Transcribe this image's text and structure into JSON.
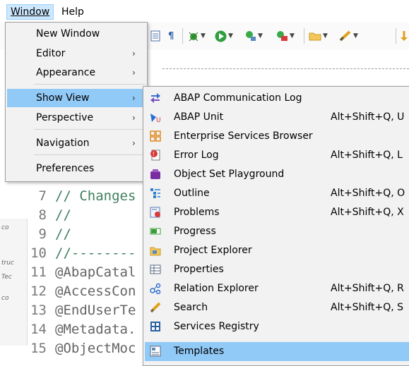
{
  "menubar": {
    "window": "Window",
    "help": "Help"
  },
  "window_menu": {
    "items": [
      {
        "label": "New Window",
        "has_submenu": false
      },
      {
        "label": "Editor",
        "has_submenu": true
      },
      {
        "label": "Appearance",
        "has_submenu": true
      },
      {
        "label": "Show View",
        "has_submenu": true,
        "highlighted": true
      },
      {
        "label": "Perspective",
        "has_submenu": true
      },
      {
        "label": "Navigation",
        "has_submenu": true
      },
      {
        "label": "Preferences",
        "has_submenu": false
      }
    ],
    "arrow": "›"
  },
  "show_view_menu": {
    "items": [
      {
        "label": "ABAP Communication Log",
        "accelerator": "",
        "icon": "communication-log-icon"
      },
      {
        "label": "ABAP Unit",
        "accelerator": "Alt+Shift+Q, U",
        "icon": "abap-unit-icon"
      },
      {
        "label": "Enterprise Services Browser",
        "accelerator": "",
        "icon": "enterprise-services-icon"
      },
      {
        "label": "Error Log",
        "accelerator": "Alt+Shift+Q, L",
        "icon": "error-log-icon"
      },
      {
        "label": "Object Set Playground",
        "accelerator": "",
        "icon": "object-set-icon"
      },
      {
        "label": "Outline",
        "accelerator": "Alt+Shift+Q, O",
        "icon": "outline-icon"
      },
      {
        "label": "Problems",
        "accelerator": "Alt+Shift+Q, X",
        "icon": "problems-icon"
      },
      {
        "label": "Progress",
        "accelerator": "",
        "icon": "progress-icon"
      },
      {
        "label": "Project Explorer",
        "accelerator": "",
        "icon": "project-explorer-icon"
      },
      {
        "label": "Properties",
        "accelerator": "",
        "icon": "properties-icon"
      },
      {
        "label": "Relation Explorer",
        "accelerator": "Alt+Shift+Q, R",
        "icon": "relation-explorer-icon"
      },
      {
        "label": "Search",
        "accelerator": "Alt+Shift+Q, S",
        "icon": "search-icon"
      },
      {
        "label": "Services Registry",
        "accelerator": "",
        "icon": "services-registry-icon"
      },
      {
        "label": "Templates",
        "accelerator": "",
        "icon": "templates-icon",
        "highlighted": true
      }
    ]
  },
  "editor": {
    "lines": [
      {
        "num": "7",
        "text": "// Changes"
      },
      {
        "num": "8",
        "text": "//"
      },
      {
        "num": "9",
        "text": "//"
      },
      {
        "num": "10",
        "text": "//--------"
      },
      {
        "num": "11",
        "text": "@AbapCatal"
      },
      {
        "num": "12",
        "text": "@AccessCon"
      },
      {
        "num": "13",
        "text": "@EndUserTe"
      },
      {
        "num": "14",
        "text": "@Metadata."
      },
      {
        "num": "15",
        "text": "@ObjectMoc"
      }
    ],
    "strip_fragments": [
      "co",
      "truc",
      "Tec",
      "co"
    ]
  },
  "colors": {
    "menu_bg": "#f2f2f2",
    "highlight": "#91c9f7",
    "comment": "#3f7f5f",
    "annotation": "#646464",
    "line_number": "#787878"
  }
}
